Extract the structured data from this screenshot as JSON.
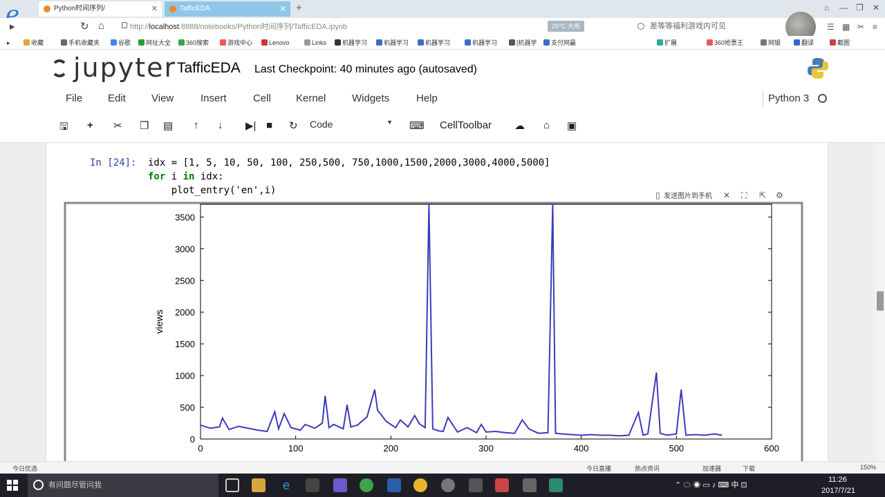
{
  "browser": {
    "tabs": [
      {
        "label": "Python时间序列/",
        "active": true
      },
      {
        "label": "TafficEDA",
        "active": false
      }
    ],
    "new_tab": "+",
    "url_prefix": "http://",
    "url_host": "localhost",
    "url_rest": ":8888/notebooks/Python时间序列/TafficEDA.ipynb",
    "weather": "29°C 大雨",
    "headline": "差等等福利游戏内可见",
    "window_controls": [
      "⌂",
      "—",
      "❐",
      "✕"
    ],
    "bookmarks": [
      "收藏",
      "手机收藏夹",
      "谷歌",
      "网址大全",
      "360搜索",
      "游戏中心",
      "Lenovo",
      "Links",
      "机器学习",
      "机器学习",
      "机器学习",
      "机器学习",
      "[机器学",
      "支付网最",
      "扩展",
      "360抢票王",
      "网银",
      "翻译",
      "截图"
    ]
  },
  "jupyter": {
    "logo_text": "jupyter",
    "notebook_name": "TafficEDA",
    "checkpoint": "Last Checkpoint: 40 minutes ago (autosaved)",
    "menu": [
      "File",
      "Edit",
      "View",
      "Insert",
      "Cell",
      "Kernel",
      "Widgets",
      "Help"
    ],
    "kernel": "Python 3",
    "cell_type": "Code",
    "cell_toolbar": "CellToolbar"
  },
  "cell": {
    "prompt": "In [24]:",
    "line1_prefix": "idx = ",
    "line1_list": "[1, 5, 10, 50, 100, 250,500, 750,1000,1500,2000,3000,4000,5000]",
    "line2_kw1": "for",
    "line2_mid": " i ",
    "line2_kw2": "in",
    "line2_rest": " idx:",
    "line3": "    plot_entry('en',i)",
    "figure_tool_label": "发送图片到手机"
  },
  "chart_data": {
    "type": "line",
    "xlabel": "",
    "ylabel": "views",
    "xlim": [
      0,
      600
    ],
    "ylim": [
      0,
      3700
    ],
    "xticks": [
      0,
      100,
      200,
      300,
      400,
      500,
      600
    ],
    "yticks": [
      0,
      500,
      1000,
      1500,
      2000,
      2500,
      3000,
      3500
    ],
    "color": "#3b3bbd",
    "series": [
      {
        "x": [
          0,
          10,
          20,
          23,
          30,
          40,
          50,
          60,
          70,
          78,
          82,
          88,
          95,
          105,
          110,
          120,
          128,
          131,
          135,
          140,
          150,
          154,
          158,
          165,
          175,
          183,
          186,
          190,
          195,
          205,
          210,
          218,
          225,
          230,
          236,
          240,
          244,
          250,
          255,
          260,
          270,
          280,
          290,
          295,
          300,
          310,
          320,
          330,
          338,
          345,
          355,
          365,
          370,
          373,
          380,
          390,
          400,
          410,
          420,
          430,
          440,
          450,
          460,
          465,
          470,
          479,
          483,
          490,
          500,
          505,
          510,
          520,
          530,
          540,
          548
        ],
        "y": [
          220,
          170,
          190,
          330,
          150,
          200,
          170,
          140,
          120,
          430,
          160,
          400,
          180,
          140,
          230,
          170,
          250,
          680,
          180,
          230,
          160,
          540,
          190,
          220,
          350,
          780,
          450,
          380,
          280,
          180,
          300,
          190,
          370,
          240,
          180,
          3700,
          160,
          130,
          120,
          340,
          110,
          180,
          100,
          230,
          110,
          120,
          100,
          90,
          300,
          160,
          90,
          100,
          3700,
          90,
          80,
          70,
          60,
          70,
          60,
          60,
          50,
          60,
          420,
          60,
          80,
          1050,
          90,
          60,
          80,
          780,
          60,
          70,
          60,
          80,
          60
        ]
      }
    ]
  },
  "statusbar": {
    "left": "今日优选",
    "items": [
      "今日直播",
      "热点资讯",
      "加速器",
      "下载"
    ],
    "zoom": "150%"
  },
  "taskbar": {
    "search_placeholder": "有问题尽管问我",
    "ime": "中",
    "time": "11:26",
    "date": "2017/7/21"
  }
}
